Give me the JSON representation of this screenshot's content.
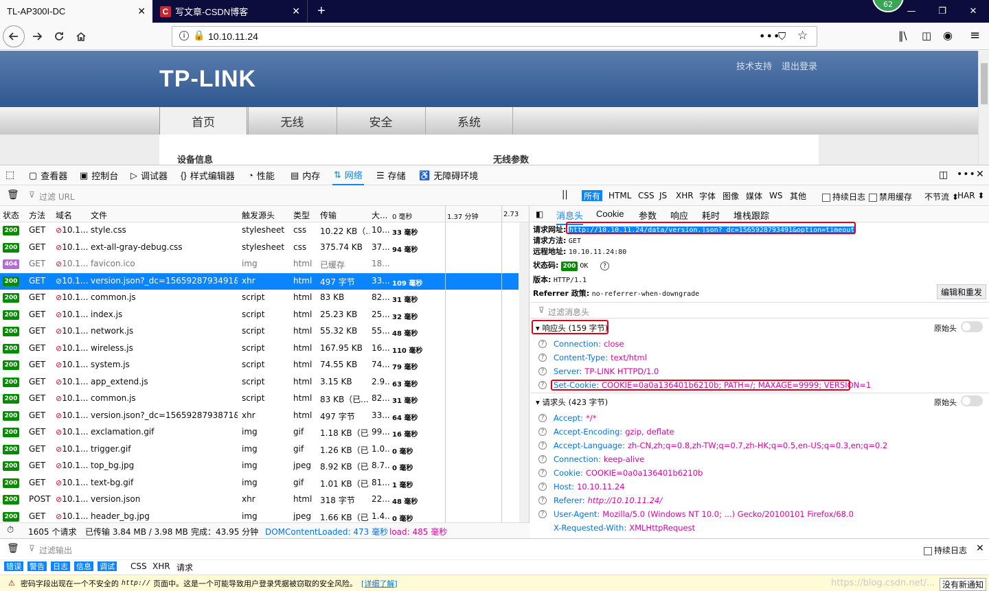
{
  "browser": {
    "tabs": [
      {
        "title": "TL-AP300I-DC",
        "active": true
      },
      {
        "title": "写文章-CSDN博客",
        "active": false,
        "favicon": "C"
      }
    ],
    "new_tab": "+",
    "badge": "62",
    "window": {
      "minimize": "—",
      "restore": "❐",
      "close": "✕"
    },
    "url": "10.10.11.24"
  },
  "site": {
    "logo": "TP-LINK",
    "links": [
      "技术支持",
      "退出登录"
    ],
    "menu": [
      "首页",
      "无线",
      "安全",
      "系统"
    ],
    "left_section": "设备信息",
    "right_section": "无线参数"
  },
  "devtools": {
    "tabs": [
      "查看器",
      "控制台",
      "调试器",
      "样式编辑器",
      "性能",
      "内存",
      "网络",
      "存储",
      "无障碍环境"
    ],
    "filter_url_placeholder": "过滤 URL",
    "type_filters": [
      "所有",
      "HTML",
      "CSS",
      "JS",
      "XHR",
      "字体",
      "图像",
      "媒体",
      "WS",
      "其他"
    ],
    "persist_log": "持续日志",
    "disable_cache": "禁用缓存",
    "throttle": "不节流",
    "har": "HAR",
    "columns": [
      "状态",
      "方法",
      "域名",
      "文件",
      "触发源头",
      "类型",
      "传输",
      "大...",
      "0 毫秒",
      "1.37 分钟",
      "2.73"
    ],
    "requests": [
      {
        "status": "200",
        "method": "GET",
        "domain": "10.1...",
        "file": "style.css",
        "cause": "stylesheet",
        "type": "css",
        "transfer": "10.22 KB（...",
        "size": "10....",
        "time": "33 毫秒"
      },
      {
        "status": "200",
        "method": "GET",
        "domain": "10.1...",
        "file": "ext-all-gray-debug.css",
        "cause": "stylesheet",
        "type": "css",
        "transfer": "375.74 KB",
        "size": "37...",
        "time": "94 毫秒"
      },
      {
        "status": "404",
        "method": "GET",
        "domain": "10.1...",
        "file": "favicon.ico",
        "cause": "img",
        "type": "html",
        "transfer": "已缓存",
        "size": "18...",
        "time": ""
      },
      {
        "status": "200",
        "method": "GET",
        "domain": "10.1...",
        "file": "version.json?_dc=1565928793491&opt...",
        "cause": "xhr",
        "type": "html",
        "transfer": "497 字节",
        "size": "33...",
        "time": "109 毫秒"
      },
      {
        "status": "200",
        "method": "GET",
        "domain": "10.1...",
        "file": "common.js",
        "cause": "script",
        "type": "html",
        "transfer": "83 KB",
        "size": "82....",
        "time": "31 毫秒"
      },
      {
        "status": "200",
        "method": "GET",
        "domain": "10.1...",
        "file": "index.js",
        "cause": "script",
        "type": "html",
        "transfer": "25.23 KB",
        "size": "25....",
        "time": "32 毫秒"
      },
      {
        "status": "200",
        "method": "GET",
        "domain": "10.1...",
        "file": "network.js",
        "cause": "script",
        "type": "html",
        "transfer": "55.32 KB",
        "size": "55....",
        "time": "48 毫秒"
      },
      {
        "status": "200",
        "method": "GET",
        "domain": "10.1...",
        "file": "wireless.js",
        "cause": "script",
        "type": "html",
        "transfer": "167.95 KB",
        "size": "16....",
        "time": "110 毫秒"
      },
      {
        "status": "200",
        "method": "GET",
        "domain": "10.1...",
        "file": "system.js",
        "cause": "script",
        "type": "html",
        "transfer": "74.55 KB",
        "size": "74....",
        "time": "79 毫秒"
      },
      {
        "status": "200",
        "method": "GET",
        "domain": "10.1...",
        "file": "app_extend.js",
        "cause": "script",
        "type": "html",
        "transfer": "3.15 KB",
        "size": "2.9...",
        "time": "63 毫秒"
      },
      {
        "status": "200",
        "method": "GET",
        "domain": "10.1...",
        "file": "common.js",
        "cause": "script",
        "type": "html",
        "transfer": "83 KB（已...",
        "size": "82....",
        "time": "31 毫秒"
      },
      {
        "status": "200",
        "method": "GET",
        "domain": "10.1...",
        "file": "version.json?_dc=1565928793871&id=...",
        "cause": "xhr",
        "type": "html",
        "transfer": "497 字节",
        "size": "33...",
        "time": "64 毫秒"
      },
      {
        "status": "200",
        "method": "GET",
        "domain": "10.1...",
        "file": "exclamation.gif",
        "cause": "img",
        "type": "gif",
        "transfer": "1.18 KB（已...",
        "size": "99...",
        "time": "16 毫秒"
      },
      {
        "status": "200",
        "method": "GET",
        "domain": "10.1...",
        "file": "trigger.gif",
        "cause": "img",
        "type": "gif",
        "transfer": "1.26 KB（已...",
        "size": "1.0...",
        "time": "0 毫秒"
      },
      {
        "status": "200",
        "method": "GET",
        "domain": "10.1...",
        "file": "top_bg.jpg",
        "cause": "img",
        "type": "jpeg",
        "transfer": "8.92 KB（已...",
        "size": "8.7...",
        "time": "0 毫秒"
      },
      {
        "status": "200",
        "method": "GET",
        "domain": "10.1...",
        "file": "text-bg.gif",
        "cause": "img",
        "type": "gif",
        "transfer": "1.01 KB（已...",
        "size": "81...",
        "time": "1 毫秒"
      },
      {
        "status": "200",
        "method": "POST",
        "domain": "10.1...",
        "file": "version.json",
        "cause": "xhr",
        "type": "html",
        "transfer": "318 字节",
        "size": "22...",
        "time": "48 毫秒"
      },
      {
        "status": "200",
        "method": "GET",
        "domain": "10.1...",
        "file": "header_bg.jpg",
        "cause": "img",
        "type": "jpeg",
        "transfer": "1.66 KB（已...",
        "size": "1.4...",
        "time": "0 毫秒"
      }
    ],
    "status_bar": {
      "requests": "1605 个请求",
      "transferred": "已传输 3.84 MB / 3.98 MB",
      "finish": "完成：43.95 分钟",
      "dom": "DOMContentLoaded: 473 毫秒",
      "load": "load: 485 毫秒"
    },
    "detail_tabs": [
      "消息头",
      "Cookie",
      "参数",
      "响应",
      "耗时",
      "堆栈跟踪"
    ],
    "summary": {
      "url_label": "请求网址:",
      "url": "http://10.10.11.24/data/version.json?_dc=1565928793491&option=timeout",
      "method_label": "请求方法:",
      "method": "GET",
      "remote_label": "远程地址:",
      "remote": "10.10.11.24:80",
      "status_label": "状态码:",
      "status_code": "200",
      "status_text": "OK",
      "version_label": "版本:",
      "version": "HTTP/1.1",
      "referrer_label": "Referrer 政策:",
      "referrer": "no-referrer-when-downgrade",
      "edit_resend": "编辑和重发"
    },
    "filter_headers_placeholder": "过滤消息头",
    "raw_headers": "原始头",
    "response_headers_title": "响应头 (159 字节)",
    "response_headers": [
      {
        "k": "Connection:",
        "v": "close"
      },
      {
        "k": "Content-Type:",
        "v": "text/html"
      },
      {
        "k": "Server:",
        "v": "TP-LINK HTTPD/1.0"
      },
      {
        "k": "Set-Cookie:",
        "v": "COOKIE=0a0a136401b6210b; PATH=/; MAXAGE=9999; VERSION=1"
      }
    ],
    "request_headers_title": "请求头 (423 字节)",
    "request_headers": [
      {
        "k": "Accept:",
        "v": "*/*"
      },
      {
        "k": "Accept-Encoding:",
        "v": "gzip, deflate"
      },
      {
        "k": "Accept-Language:",
        "v": "zh-CN,zh;q=0.8,zh-TW;q=0.7,zh-HK;q=0.5,en-US;q=0.3,en;q=0.2"
      },
      {
        "k": "Connection:",
        "v": "keep-alive"
      },
      {
        "k": "Cookie:",
        "v": "COOKIE=0a0a136401b6210b"
      },
      {
        "k": "Host:",
        "v": "10.10.11.24"
      },
      {
        "k": "Referer:",
        "v": "http://10.10.11.24/"
      },
      {
        "k": "User-Agent:",
        "v": "Mozilla/5.0 (Windows NT 10.0; ...) Gecko/20100101 Firefox/68.0"
      },
      {
        "k": "X-Requested-With:",
        "v": "XMLHttpRequest"
      }
    ],
    "console": {
      "filter_placeholder": "过滤输出",
      "persist_log": "持续日志",
      "levels": [
        "错误",
        "警告",
        "日志",
        "信息",
        "调试"
      ],
      "categories": [
        "CSS",
        "XHR",
        "请求"
      ],
      "warning_prefix": "密码字段出现在一个不安全的",
      "warning_code": "http://",
      "warning_suffix": "页面中。这是一个可能导致用户登录凭据被窃取的安全风险。",
      "learn_more": "[详细了解]",
      "notification": "没有新通知",
      "watermark": "https://blog.csdn.net/..."
    }
  }
}
